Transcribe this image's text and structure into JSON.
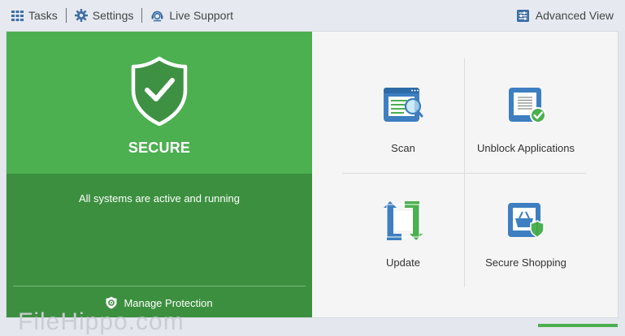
{
  "topbar": {
    "tasks_label": "Tasks",
    "settings_label": "Settings",
    "support_label": "Live Support",
    "advanced_label": "Advanced View"
  },
  "status": {
    "title": "SECURE",
    "message": "All systems are active and running",
    "manage_label": "Manage Protection"
  },
  "tiles": [
    {
      "label": "Scan",
      "icon": "scan-icon"
    },
    {
      "label": "Unblock Applications",
      "icon": "unblock-applications-icon"
    },
    {
      "label": "Update",
      "icon": "update-icon"
    },
    {
      "label": "Secure Shopping",
      "icon": "secure-shopping-icon"
    }
  ],
  "watermark": "FileHippo.com",
  "colors": {
    "green_light": "#4caf50",
    "green_dark": "#3c8f3f",
    "icon_blue": "#3d7fc1"
  }
}
